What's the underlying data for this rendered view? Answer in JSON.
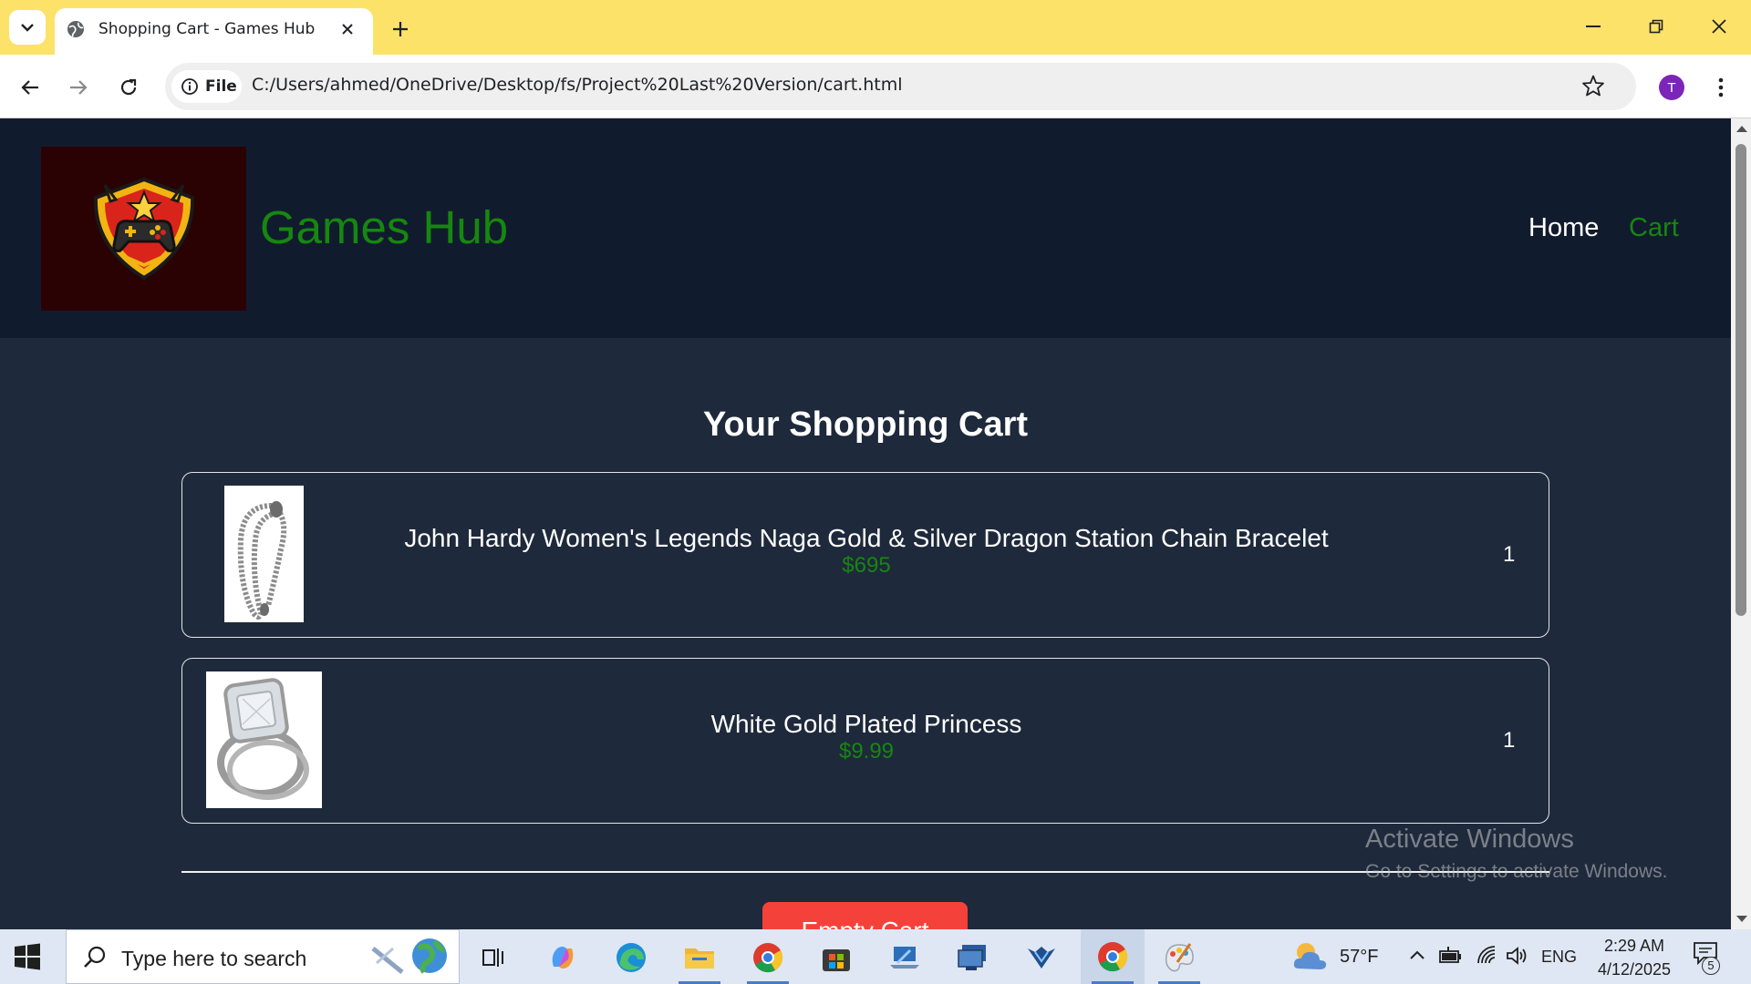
{
  "browser": {
    "tab_title": "Shopping Cart - Games Hub",
    "site_chip_label": "File",
    "url": "C:/Users/ahmed/OneDrive/Desktop/fs/Project%20Last%20Version/cart.html",
    "profile_initial": "T",
    "accent": "#fde26a"
  },
  "site": {
    "title": "Games Hub",
    "nav": {
      "home": "Home",
      "cart": "Cart"
    },
    "accent": "#16870f"
  },
  "cart": {
    "heading": "Your Shopping Cart",
    "items": [
      {
        "name": "John Hardy Women's Legends Naga Gold & Silver Dragon Station Chain Bracelet",
        "price": "$695",
        "qty": "1",
        "image": "bracelet"
      },
      {
        "name": "White Gold Plated Princess",
        "price": "$9.99",
        "qty": "1",
        "image": "ring"
      }
    ],
    "empty_button": "Empty Cart"
  },
  "watermark": {
    "title": "Activate Windows",
    "subtitle": "Go to Settings to activate Windows."
  },
  "taskbar": {
    "search_placeholder": "Type here to search",
    "weather": "57°F",
    "language": "ENG",
    "time": "2:29 AM",
    "date": "4/12/2025",
    "notifications": "5"
  }
}
